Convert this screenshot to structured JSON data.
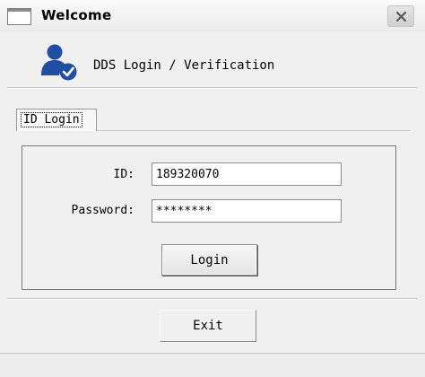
{
  "window": {
    "title": "Welcome"
  },
  "header": {
    "text": "DDS Login / Verification",
    "icon": "user-verified-icon"
  },
  "tabs": [
    {
      "label": "ID Login",
      "selected": true
    }
  ],
  "form": {
    "id_label": "ID:",
    "id_value": "189320070",
    "password_label": "Password:",
    "password_value": "********",
    "login_label": "Login"
  },
  "footer": {
    "exit_label": "Exit"
  },
  "colors": {
    "icon_blue": "#1f4ea3",
    "background": "#f0f0f0"
  }
}
